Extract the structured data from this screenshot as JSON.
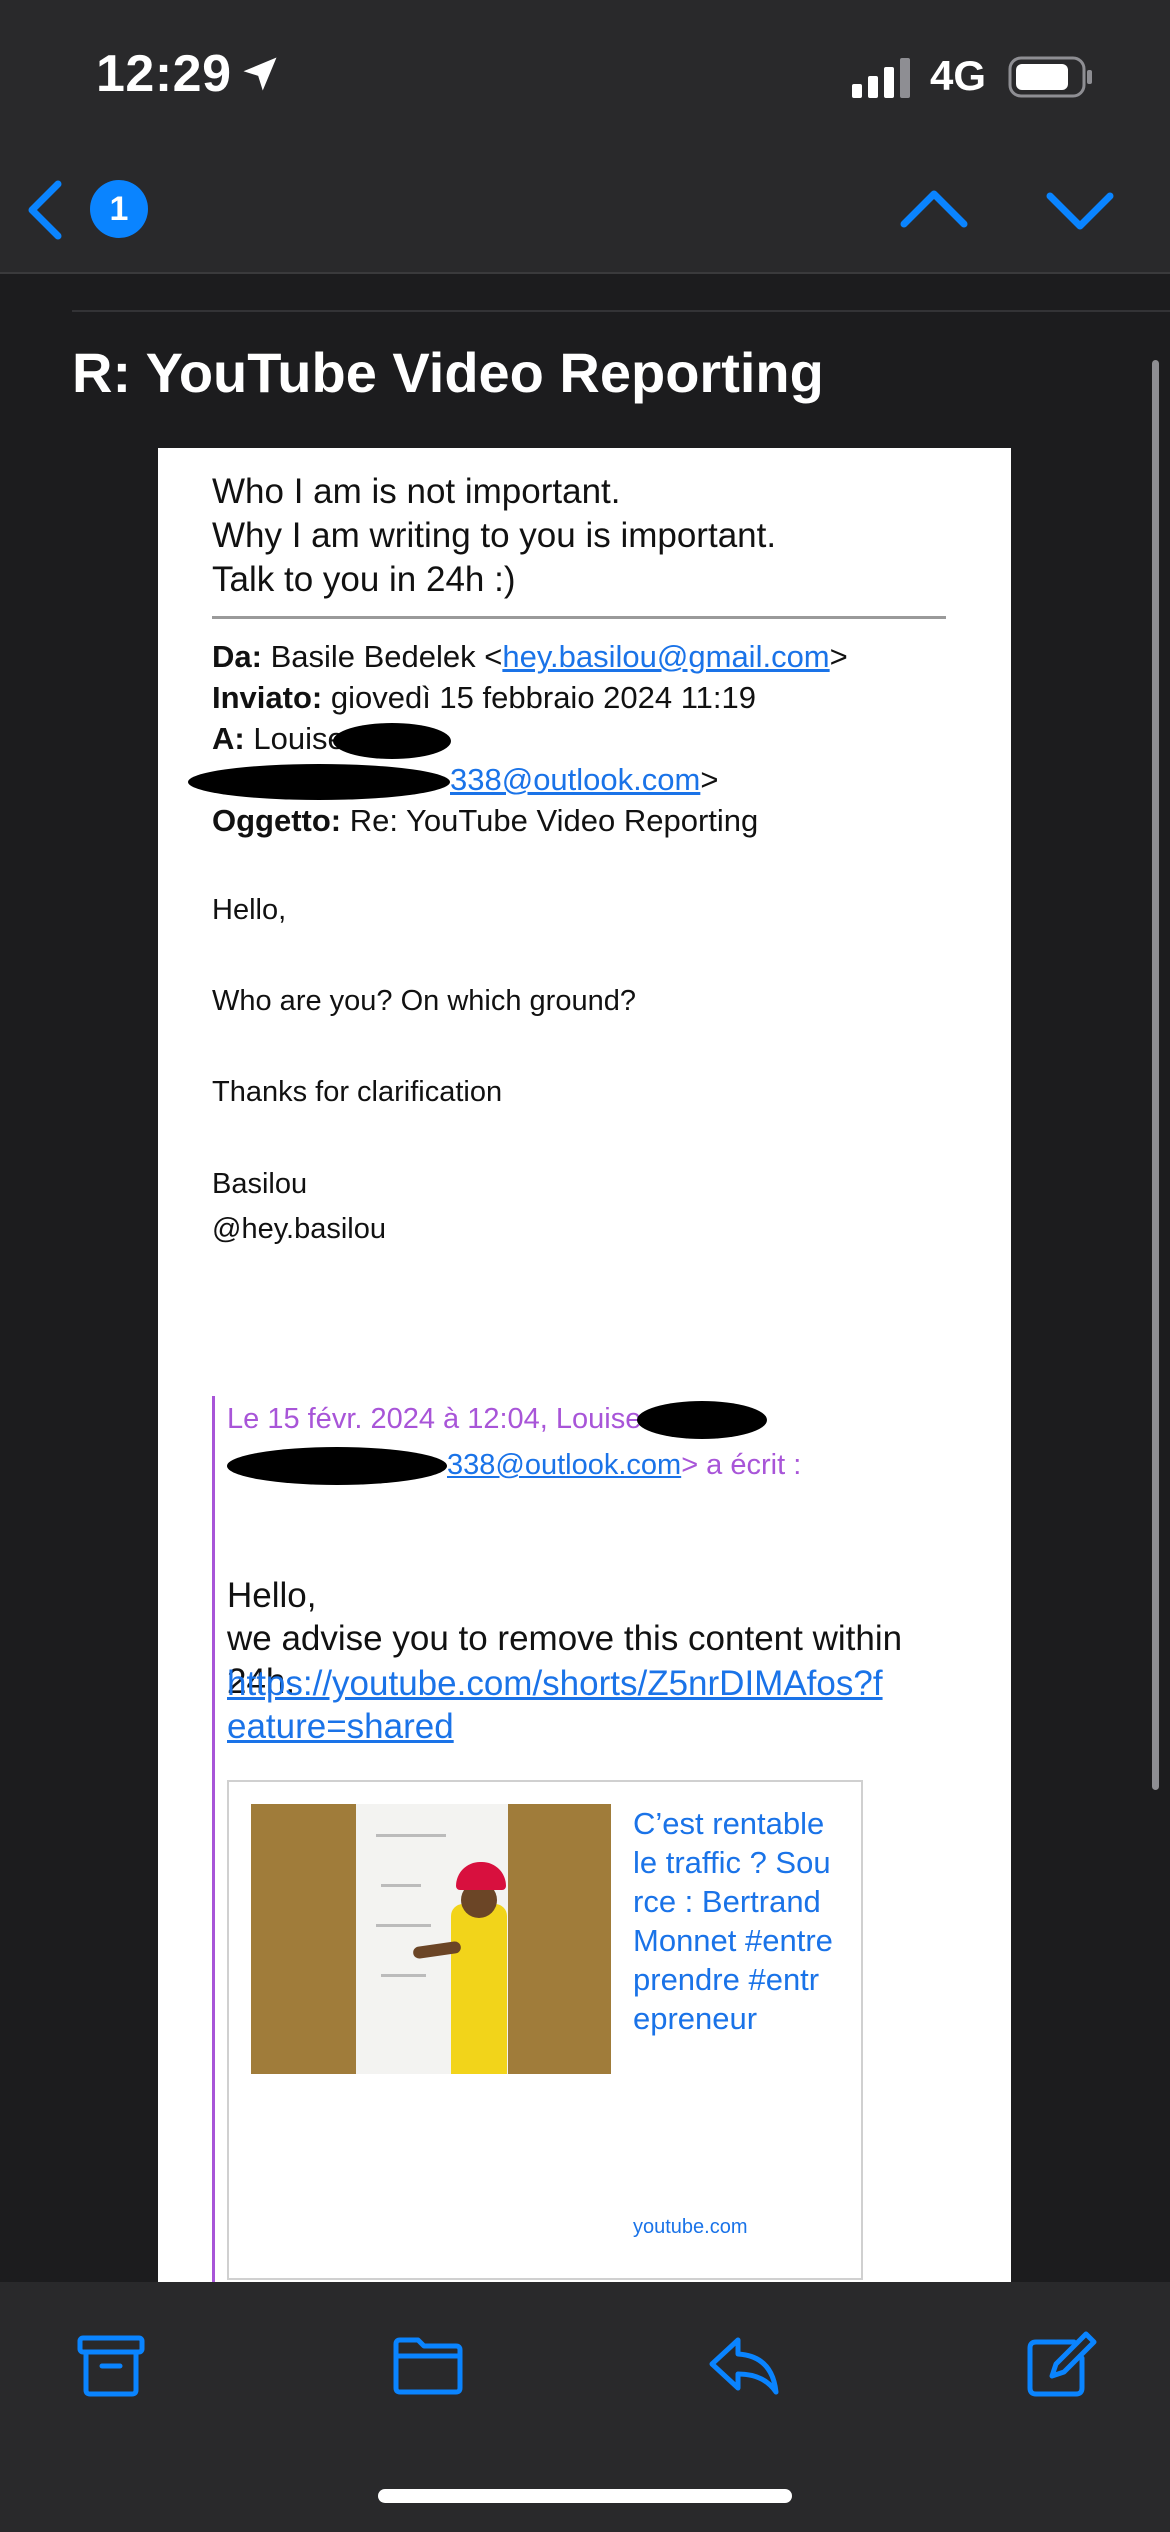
{
  "status_bar": {
    "time": "12:29",
    "network": "4G",
    "icons": [
      "location-arrow-icon",
      "signal-icon",
      "battery-icon"
    ]
  },
  "nav": {
    "unread_count": "1",
    "icons": [
      "back-chevron-icon",
      "up-chevron-icon",
      "down-chevron-icon"
    ]
  },
  "email": {
    "subject": "R: YouTube Video Reporting",
    "signature_lines": [
      "Who I am is not important.",
      "Why I am writing to you is important.",
      "Talk to you in 24h :)"
    ],
    "header": {
      "from_label": "Da:",
      "from_name": "Basile Bedelek <",
      "from_email": "hey.basilou@gmail.com",
      "from_close": ">",
      "sent_label": "Inviato:",
      "sent_value": "giovedì 15 febbraio 2024 11:19",
      "to_label": "A:",
      "to_value": "Louise",
      "to_email_visible": "338@outlook.com",
      "to_close": ">",
      "subject_label": "Oggetto:",
      "subject_value": "Re: YouTube Video Reporting"
    },
    "body_lines": [
      "Hello,",
      "Who are you? On which ground?",
      "Thanks for clarification",
      "Basilou",
      "@hey.basilou"
    ],
    "quote": {
      "header_line1": "Le 15 févr. 2024 à 12:04, Louise",
      "header_email": "338@outlook.com",
      "header_suffix": "> a écrit :",
      "greeting": "Hello,",
      "text": "we advise you to remove this content within 24h.",
      "link": "https://youtube.com/shorts/Z5nrDIMAfos?feature=shared",
      "preview": {
        "title": "C’est rentable le traffic ? Source : Bertrand Monnet #entreprendre #entrepreneur",
        "source": "youtube.com"
      }
    }
  },
  "toolbar": {
    "icons": [
      "archive-icon",
      "folder-icon",
      "reply-icon",
      "compose-icon"
    ]
  },
  "colors": {
    "accent": "#0a84ff",
    "link": "#1a73e8",
    "quote": "#a855d8",
    "background": "#1c1c1e",
    "bar": "#29292b"
  }
}
